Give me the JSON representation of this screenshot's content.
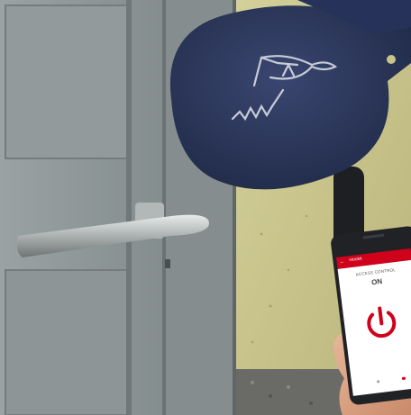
{
  "app": {
    "bar_title": "Hookit",
    "heading": "ACCESS CONTROL",
    "state": "ON"
  },
  "colors": {
    "brand_red": "#d0021b",
    "fob_navy": "#2a3558",
    "wall_beige": "#c9c58a",
    "door_grey": "#8d9596"
  },
  "icons": [
    "power-icon",
    "back-arrow-icon",
    "fish-logo-icon"
  ]
}
